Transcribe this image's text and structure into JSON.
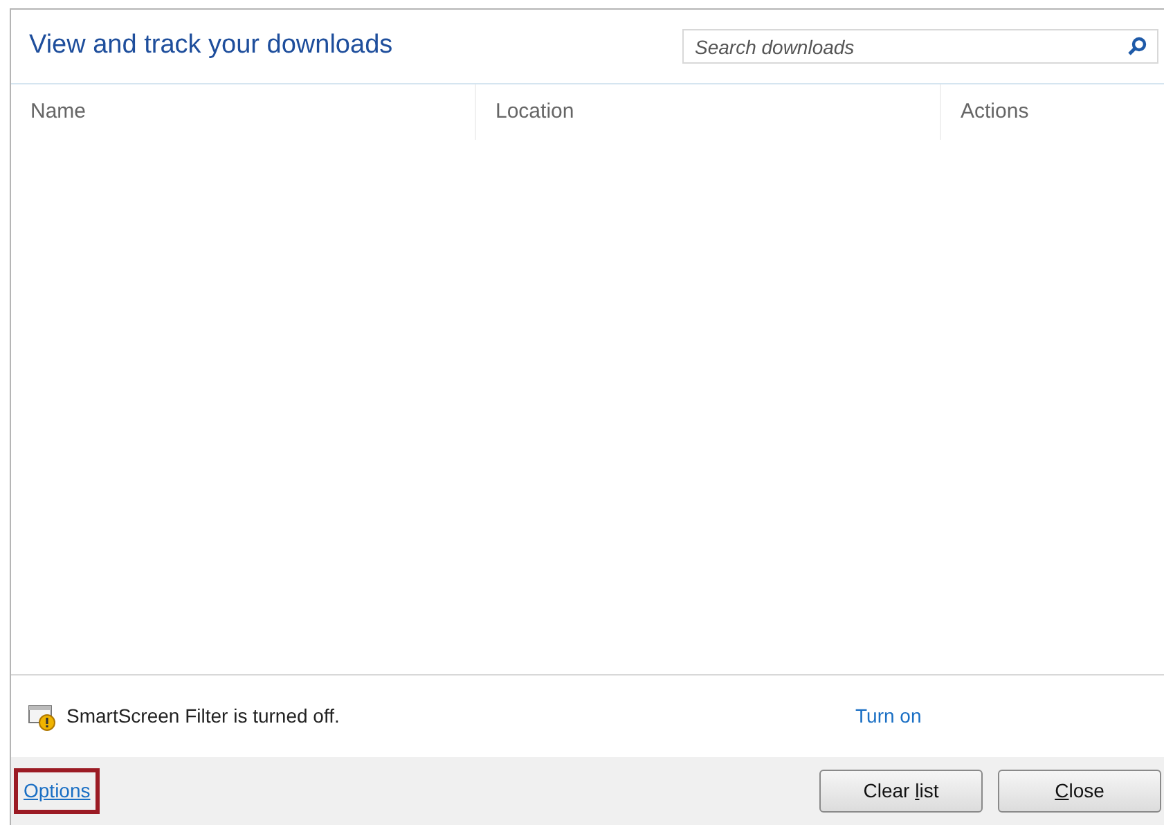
{
  "header": {
    "title": "View and track your downloads",
    "search": {
      "placeholder": "Search downloads"
    }
  },
  "table": {
    "columns": [
      "Name",
      "Location",
      "Actions"
    ]
  },
  "notice": {
    "text": "SmartScreen Filter is turned off.",
    "link": "Turn on"
  },
  "footer": {
    "options_link": {
      "label": "Options",
      "highlighted": true
    },
    "buttons": [
      {
        "before": "Clear ",
        "key": "l",
        "after": "ist"
      },
      {
        "key": "C",
        "after": "lose"
      }
    ]
  }
}
